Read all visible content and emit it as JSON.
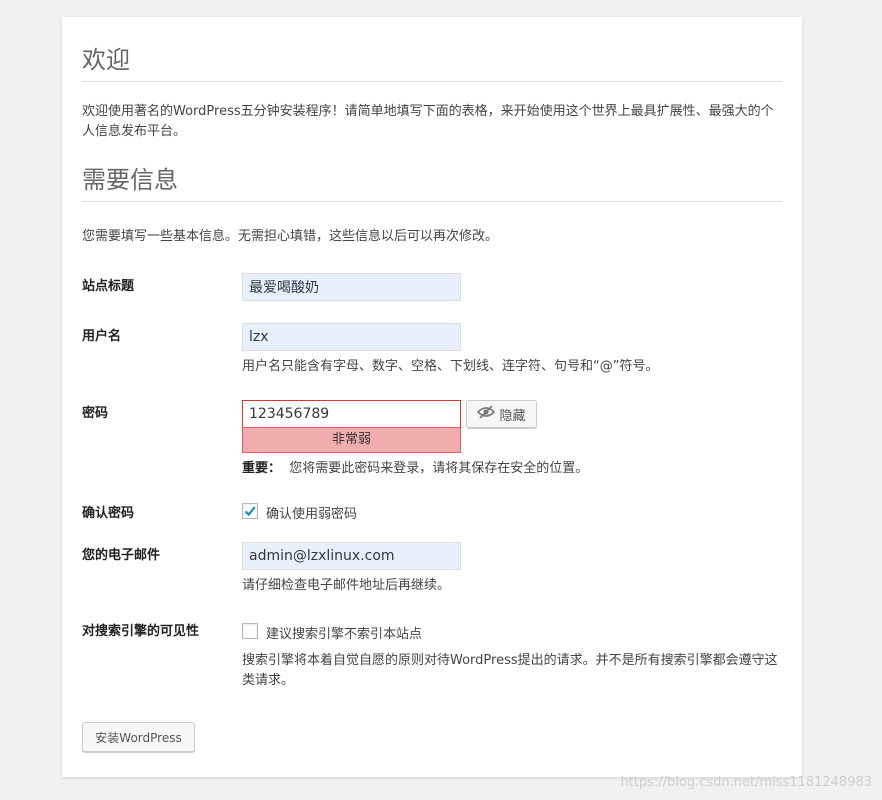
{
  "welcome": {
    "title": "欢迎",
    "text": "欢迎使用著名的WordPress五分钟安装程序！请简单地填写下面的表格，来开始使用这个世界上最具扩展性、最强大的个人信息发布平台。"
  },
  "info": {
    "title": "需要信息",
    "text": "您需要填写一些基本信息。无需担心填错，这些信息以后可以再次修改。"
  },
  "form": {
    "site_title": {
      "label": "站点标题",
      "value": "最爱喝酸奶"
    },
    "username": {
      "label": "用户名",
      "value": "lzx",
      "hint": "用户名只能含有字母、数字、空格、下划线、连字符、句号和“@”符号。"
    },
    "password": {
      "label": "密码",
      "value": "123456789",
      "strength": "非常弱",
      "hide_label": "隐藏",
      "hint_strong": "重要：",
      "hint": "您将需要此密码来登录，请将其保存在安全的位置。"
    },
    "confirm": {
      "label": "确认密码",
      "checkbox_label": "确认使用弱密码",
      "checked": true
    },
    "email": {
      "label": "您的电子邮件",
      "value": "admin@lzxlinux.com",
      "hint": "请仔细检查电子邮件地址后再继续。"
    },
    "visibility": {
      "label": "对搜索引擎的可见性",
      "checkbox_label": "建议搜索引擎不索引本站点",
      "checked": false,
      "hint": "搜索引擎将本着自觉自愿的原则对待WordPress提出的请求。并不是所有搜索引擎都会遵守这类请求。"
    },
    "submit_label": "安装WordPress"
  },
  "watermark": "https://blog.csdn.net/miss1181248983",
  "colors": {
    "accent": "#0073aa",
    "weak_bg": "#f1adad",
    "weak_border": "#e35b5b",
    "autofill_bg": "#e8f0fe"
  },
  "icons": {
    "hide": "eye-slash-icon",
    "check": "checkmark-icon"
  }
}
